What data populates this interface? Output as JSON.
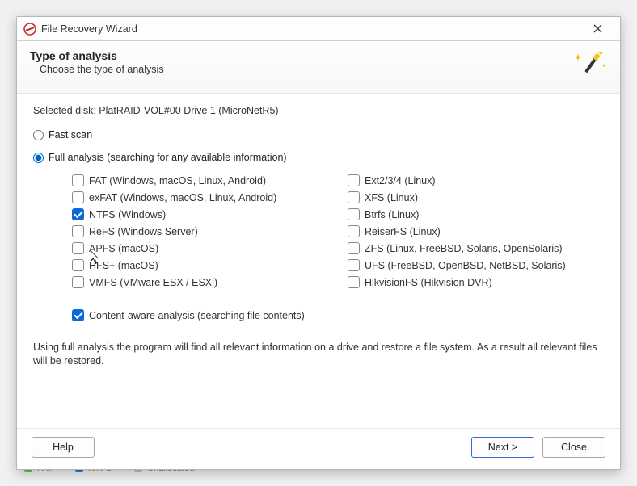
{
  "window": {
    "title": "File Recovery Wizard"
  },
  "header": {
    "heading": "Type of analysis",
    "sub": "Choose the type of analysis"
  },
  "selected_disk_line": "Selected disk: PlatRAID-VOL#00 Drive 1 (MicroNetR5)",
  "scan_modes": {
    "fast_label": "Fast scan",
    "full_label": "Full analysis (searching for any available information)",
    "selected": "full"
  },
  "filesystems": {
    "left": [
      {
        "id": "fat",
        "label": "FAT (Windows, macOS, Linux, Android)",
        "checked": false
      },
      {
        "id": "exfat",
        "label": "exFAT (Windows, macOS, Linux, Android)",
        "checked": false
      },
      {
        "id": "ntfs",
        "label": "NTFS (Windows)",
        "checked": true
      },
      {
        "id": "refs",
        "label": "ReFS (Windows Server)",
        "checked": false
      },
      {
        "id": "apfs",
        "label": "APFS (macOS)",
        "checked": false
      },
      {
        "id": "hfsp",
        "label": "HFS+ (macOS)",
        "checked": false
      },
      {
        "id": "vmfs",
        "label": "VMFS (VMware ESX / ESXi)",
        "checked": false
      }
    ],
    "right": [
      {
        "id": "ext",
        "label": "Ext2/3/4 (Linux)",
        "checked": false
      },
      {
        "id": "xfs",
        "label": "XFS (Linux)",
        "checked": false
      },
      {
        "id": "btrfs",
        "label": "Btrfs (Linux)",
        "checked": false
      },
      {
        "id": "reiser",
        "label": "ReiserFS (Linux)",
        "checked": false
      },
      {
        "id": "zfs",
        "label": "ZFS (Linux, FreeBSD, Solaris, OpenSolaris)",
        "checked": false
      },
      {
        "id": "ufs",
        "label": "UFS (FreeBSD, OpenBSD, NetBSD, Solaris)",
        "checked": false
      },
      {
        "id": "hikfs",
        "label": "HikvisionFS (Hikvision DVR)",
        "checked": false
      }
    ]
  },
  "content_aware": {
    "label": "Content-aware analysis (searching file contents)",
    "checked": true
  },
  "explain": "Using full analysis the program will find all relevant information on a drive and restore a file system. As a result all relevant files will be restored.",
  "buttons": {
    "help": "Help",
    "next": "Next >",
    "close": "Close"
  },
  "bg_legend": {
    "fat": "FAT",
    "ntfs": "NTFS",
    "unalloc": "Unallocated"
  }
}
